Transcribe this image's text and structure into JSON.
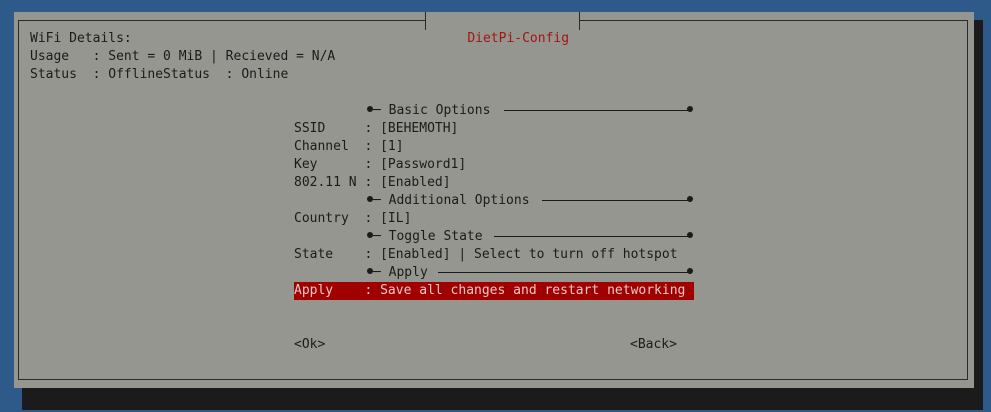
{
  "dialog": {
    "title": "DietPi-Config",
    "details": [
      "WiFi Details:",
      "Usage   : Sent = 0 MiB | Recieved = N/A",
      "Status  : OfflineStatus  : Online"
    ]
  },
  "sections": [
    {
      "label": "Basic Options"
    },
    {
      "label": "Additional Options"
    },
    {
      "label": "Toggle State"
    },
    {
      "label": "Apply"
    }
  ],
  "menu": [
    {
      "key": "SSID     ",
      "value": "[BEHEMOTH]"
    },
    {
      "key": "Channel  ",
      "value": "[1]"
    },
    {
      "key": "Key      ",
      "value": "[Password1]"
    },
    {
      "key": "802.11 N ",
      "value": "[Enabled]"
    },
    {
      "key": "Country  ",
      "value": "[IL]"
    },
    {
      "key": "State    ",
      "value": "[Enabled] | Select to turn off hotspot"
    },
    {
      "key": "Apply    ",
      "value": "Save all changes and restart networking"
    }
  ],
  "buttons": {
    "ok": "<Ok>",
    "back": "<Back>"
  },
  "colors": {
    "background": "#2e5a8a",
    "dialog": "#969690",
    "title": "#a11515",
    "highlight": "#a00000"
  }
}
